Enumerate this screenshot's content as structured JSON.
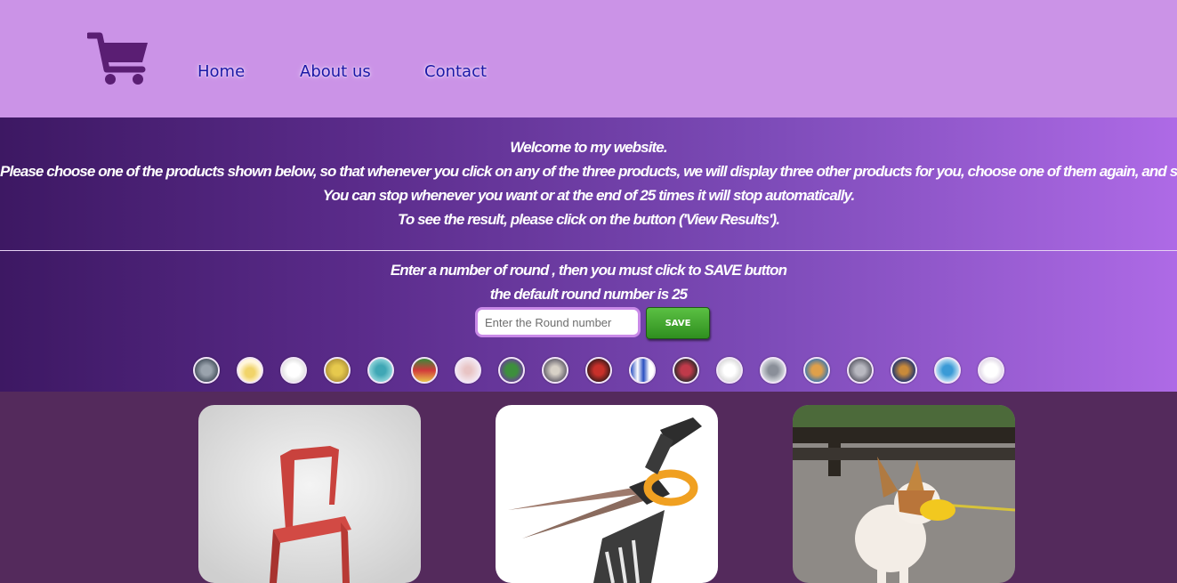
{
  "header": {
    "logo_icon": "shopping-cart-icon",
    "nav": [
      {
        "label": "Home"
      },
      {
        "label": "About us"
      },
      {
        "label": "Contact"
      }
    ]
  },
  "intro": {
    "lines": [
      "Welcome to my website.",
      "Please choose one of the products shown below, so that whenever you click on any of the three products, we will display three other products for you, choose one of them again, and so on.",
      "You can stop whenever you want or at the end of 25 times it will stop automatically.",
      "To see the result, please click on the button ('View Results')."
    ]
  },
  "rounds": {
    "instruction_line1": "Enter a number of round , then you must click to SAVE button",
    "instruction_line2": "the default round number is 25",
    "input_placeholder": "Enter the Round number",
    "save_label": "SAVE"
  },
  "thumbnails": [
    "bag",
    "banana",
    "bathroom",
    "boots",
    "breakfast",
    "bubblegum",
    "chair",
    "cthulhu",
    "dog-duck",
    "dragon",
    "pen",
    "pet-sweep",
    "scissors",
    "shark",
    "sweep",
    "tauntaun",
    "unicorn",
    "water-can",
    "wine-glass"
  ],
  "products": [
    {
      "name": "chair"
    },
    {
      "name": "scissors"
    },
    {
      "name": "dog-duck"
    }
  ],
  "colors": {
    "header_bg": "#cb93e7",
    "nav_link": "#1a17a6",
    "banner_gradient_start": "#3d1863",
    "banner_gradient_end": "#ae6ae6",
    "page_bg": "#542a5c",
    "save_button": "#3fa02c"
  }
}
